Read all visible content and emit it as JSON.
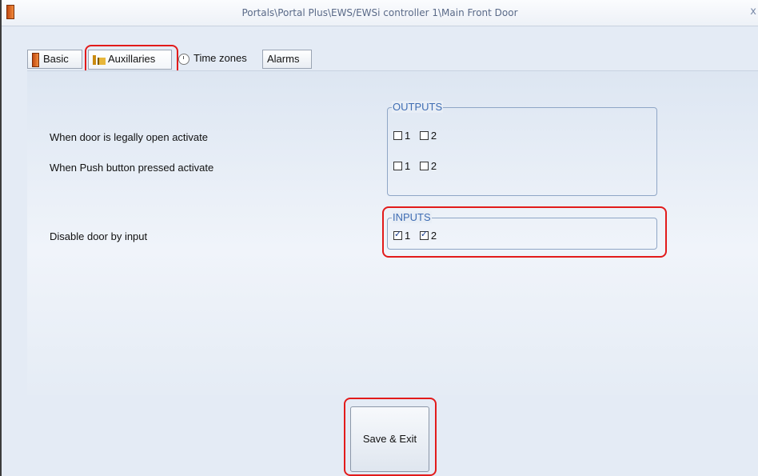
{
  "window": {
    "title": "Portals\\Portal Plus\\EWS/EWSi controller 1\\Main Front Door",
    "close": "x"
  },
  "tabs": [
    {
      "label": "Basic",
      "icon": "door-icon"
    },
    {
      "label": "Auxillaries",
      "icon": "auxiliaries-icon",
      "selected": true
    },
    {
      "label": "Time zones",
      "icon": "clock-icon"
    },
    {
      "label": "Alarms"
    }
  ],
  "auxiliaries": {
    "rows": [
      {
        "label": "When door is legally open activate"
      },
      {
        "label": "When Push button pressed activate"
      },
      {
        "label": "Disable door by input"
      }
    ],
    "outputs": {
      "title": "OUTPUTS",
      "door_open": [
        {
          "num": "1",
          "checked": false
        },
        {
          "num": "2",
          "checked": false
        }
      ],
      "push_button": [
        {
          "num": "1",
          "checked": false
        },
        {
          "num": "2",
          "checked": false
        }
      ]
    },
    "inputs": {
      "title": "INPUTS",
      "disable": [
        {
          "num": "1",
          "checked": true
        },
        {
          "num": "2",
          "checked": true
        }
      ]
    }
  },
  "buttons": {
    "save_exit": "Save & Exit"
  },
  "colors": {
    "highlight": "#e21b1b",
    "group_title": "#3f6db3"
  }
}
